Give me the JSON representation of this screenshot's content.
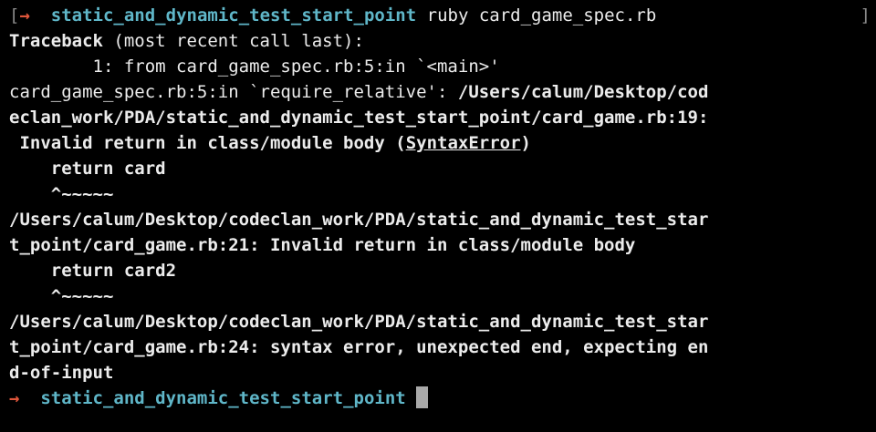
{
  "prompt": {
    "arrow": "→",
    "directory": "static_and_dynamic_test_start_point",
    "command": "ruby card_game_spec.rb"
  },
  "output": {
    "traceback_bold": "Traceback",
    "traceback_rest": " (most recent call last):",
    "frame": "        1: from card_game_spec.rb:5:in `<main>'",
    "require_prefix": "card_game_spec.rb:5:in `require_relative': ",
    "error1_path_a": "/Users/calum/Desktop/cod",
    "error1_path_b": "eclan_work/PDA/static_and_dynamic_test_start_point/card_game.rb:19:",
    "error1_msg": " Invalid return in class/module body (",
    "error1_class": "SyntaxError",
    "error1_close": ")",
    "code1": "    return card",
    "caret1": "    ^~~~~~",
    "error2_a": "/Users/calum/Desktop/codeclan_work/PDA/static_and_dynamic_test_star",
    "error2_b": "t_point/card_game.rb:21: Invalid return in class/module body",
    "code2": "    return card2",
    "caret2": "    ^~~~~~",
    "error3_a": "/Users/calum/Desktop/codeclan_work/PDA/static_and_dynamic_test_star",
    "error3_b": "t_point/card_game.rb:24: syntax error, unexpected end, expecting en",
    "error3_c": "d-of-input"
  },
  "prompt2": {
    "arrow": "→",
    "directory": "static_and_dynamic_test_start_point"
  },
  "colors": {
    "background": "#000000",
    "text": "#ececec",
    "arrow": "#e0563b",
    "directory": "#5fb6c8",
    "cursor": "#a9a9a9"
  }
}
